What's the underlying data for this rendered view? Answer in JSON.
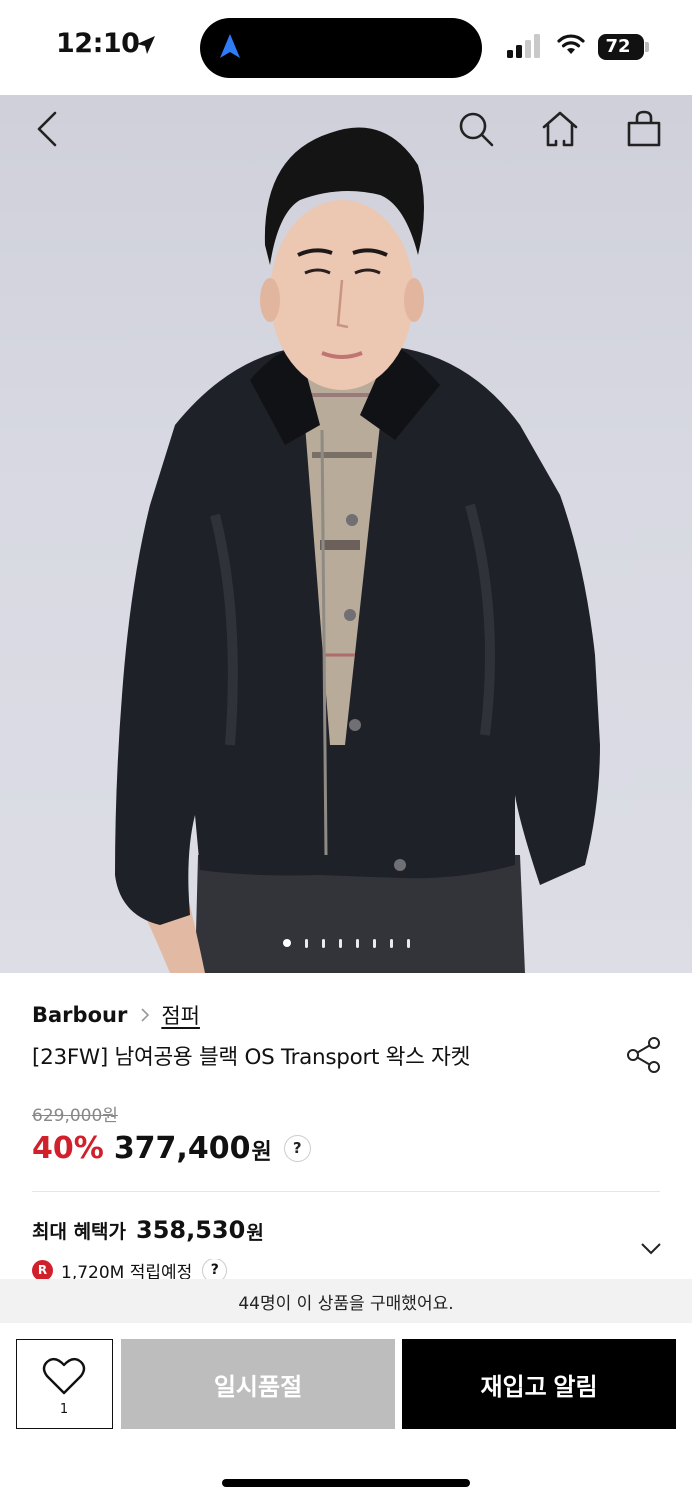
{
  "status_bar": {
    "time": "12:10",
    "battery": "72",
    "icons": [
      "location-arrow-icon",
      "navigation-icon",
      "signal-icon",
      "wifi-icon",
      "battery-icon"
    ]
  },
  "top_nav": {
    "icons": [
      "back-icon",
      "search-icon",
      "home-icon",
      "shopping-bag-icon"
    ]
  },
  "gallery": {
    "total_images": 8,
    "active_index": 0
  },
  "product": {
    "brand": "Barbour",
    "category": "점퍼",
    "title": "[23FW] 남여공용 블랙 OS Transport 왁스 자켓",
    "original_price": "629,000원",
    "discount": "40%",
    "price": "377,400",
    "price_unit": "원",
    "price_help": "?",
    "max_benefit_label": "최대 혜택가",
    "max_benefit_price": "358,530",
    "max_benefit_unit": "원",
    "points_badge": "R",
    "points_text": "1,720M 적립예정",
    "points_help": "?"
  },
  "purchase_banner": "44명이 이 상품을 구매했어요.",
  "bottom_bar": {
    "like_count": "1",
    "soldout_label": "일시품절",
    "restock_label": "재입고 알림"
  },
  "colors": {
    "discount_red": "#d0202b",
    "soldout_gray": "#bdbdbd",
    "primary_black": "#000000"
  }
}
